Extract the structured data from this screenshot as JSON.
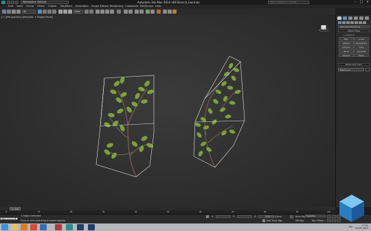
{
  "window": {
    "app_title": "Autodesk 3ds Max  2014 x64",
    "file_name": "Branch_low.max",
    "workspace": "Workspace: Default",
    "search_placeholder": "Type a keyword or phrase"
  },
  "menu": [
    "Edit",
    "Tools",
    "Group",
    "Views",
    "Create",
    "Modifiers",
    "Animation",
    "Graph Editors",
    "Rendering",
    "Customize",
    "MAXScript",
    "Help"
  ],
  "toolbar": {
    "selection_filter": "All",
    "view_dropdown": "View"
  },
  "viewport": {
    "label": "[+] [Perspective] [Realistic + Edged Faces]"
  },
  "command_panel": {
    "category": "Standard Primitives",
    "rollout_object_type": "Object Type",
    "autogrid": "AutoGrid",
    "object_buttons": [
      "Box",
      "Cone",
      "Sphere",
      "GeoSphere",
      "Cylinder",
      "Tube",
      "Torus",
      "Pyramid",
      "Teapot",
      "Plane"
    ],
    "rollout_name_color": "Name and Color",
    "object_name": "Branch_lil"
  },
  "timeline": {
    "frame_readout": "0 / 100",
    "tick_labels": [
      "0",
      "10",
      "20",
      "30",
      "40",
      "50",
      "60",
      "70",
      "80",
      "90",
      "100"
    ]
  },
  "status": {
    "objects_selected": "1 Object Selected",
    "prompt": "Click or click-and-drag to select objects",
    "maxscript_label": "Welcome to M",
    "x_label": "X:",
    "y_label": "Y:",
    "z_label": "Z:",
    "grid": "Grid = 10,0cm",
    "add_time_tag": "Add Time Tag",
    "auto_key": "Auto Key",
    "selected": "Selected",
    "set_key": "Set Key",
    "key_filters": "Key Filters..."
  },
  "taskbar": {
    "time": "17:41",
    "date": "24.05.2015",
    "lang": "EN"
  },
  "colors": {
    "selection_box": "#e6e6e6",
    "leaf": "#7fa040",
    "stem": "#6e5a4e",
    "accent_blue": "#3d8fd6",
    "auto_key_red": "#7a1d1d"
  }
}
